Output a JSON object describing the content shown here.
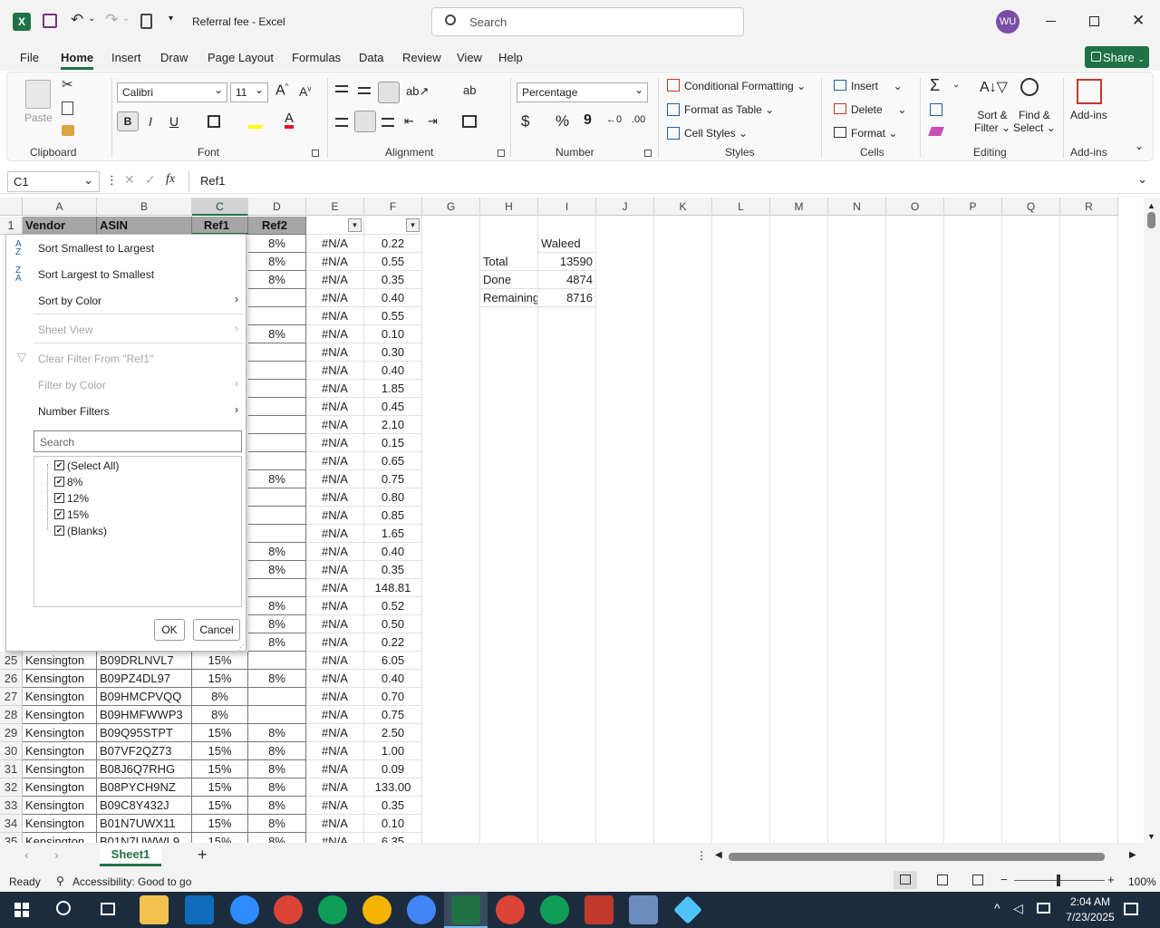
{
  "titlebar": {
    "file_title": "Referral fee",
    "app": "Excel",
    "search_placeholder": "Search",
    "user_initials": "WU"
  },
  "menu": [
    "File",
    "Home",
    "Insert",
    "Draw",
    "Page Layout",
    "Formulas",
    "Data",
    "Review",
    "View",
    "Help"
  ],
  "share_label": "Share",
  "ribbon": {
    "clipboard": {
      "paste": "Paste",
      "label": "Clipboard"
    },
    "font": {
      "name": "Calibri",
      "size": "11",
      "bold": "B",
      "italic": "I",
      "underline": "U",
      "label": "Font"
    },
    "alignment": {
      "label": "Alignment"
    },
    "number": {
      "format": "Percentage",
      "currency": "$",
      "percent": "%",
      "comma": "9",
      "label": "Number"
    },
    "styles": {
      "conditional": "Conditional Formatting",
      "table": "Format as Table",
      "cell_styles": "Cell Styles",
      "label": "Styles"
    },
    "cells": {
      "insert": "Insert",
      "delete": "Delete",
      "format": "Format",
      "label": "Cells"
    },
    "editing": {
      "sort1": "Sort &",
      "sort2": "Filter",
      "find1": "Find &",
      "find2": "Select",
      "label": "Editing"
    },
    "addins": {
      "btn": "Add-ins",
      "label": "Add-ins"
    }
  },
  "formula_bar": {
    "name_box": "C1",
    "fx": "fx",
    "value": "Ref1"
  },
  "columns": [
    "A",
    "B",
    "C",
    "D",
    "E",
    "F",
    "G",
    "H",
    "I",
    "J",
    "K",
    "L",
    "M",
    "N",
    "O",
    "P",
    "Q",
    "R"
  ],
  "row_numbers": [
    "1",
    "25",
    "26",
    "27",
    "28",
    "29",
    "30",
    "31",
    "32",
    "33",
    "34",
    "35"
  ],
  "headers": {
    "a": "Vendor",
    "b": "ASIN",
    "c": "Ref1",
    "d": "Ref2"
  },
  "d_col": [
    "8%",
    "8%",
    "8%",
    "",
    "",
    "8%",
    "",
    "",
    "",
    "",
    "",
    "",
    "",
    "8%",
    "",
    "",
    "",
    "8%",
    "8%",
    "",
    "8%",
    "8%",
    "8%"
  ],
  "e_col": [
    "#N/A",
    "#N/A",
    "#N/A",
    "#N/A",
    "#N/A",
    "#N/A",
    "#N/A",
    "#N/A",
    "#N/A",
    "#N/A",
    "#N/A",
    "#N/A",
    "#N/A",
    "#N/A",
    "#N/A",
    "#N/A",
    "#N/A",
    "#N/A",
    "#N/A",
    "#N/A",
    "#N/A",
    "#N/A",
    "#N/A"
  ],
  "f_col": [
    "0.22",
    "0.55",
    "0.35",
    "0.40",
    "0.55",
    "0.10",
    "0.30",
    "0.40",
    "1.85",
    "0.45",
    "2.10",
    "0.15",
    "0.65",
    "0.75",
    "0.80",
    "0.85",
    "1.65",
    "0.40",
    "0.35",
    "148.81",
    "0.52",
    "0.50",
    "0.22"
  ],
  "rows": [
    {
      "a": "Kensington",
      "b": "B09DRLNVL7",
      "c": "15%",
      "d": "",
      "e": "#N/A",
      "f": "6.05"
    },
    {
      "a": "Kensington",
      "b": "B09PZ4DL97",
      "c": "15%",
      "d": "8%",
      "e": "#N/A",
      "f": "0.40"
    },
    {
      "a": "Kensington",
      "b": "B09HMCPVQQ",
      "c": "8%",
      "d": "",
      "e": "#N/A",
      "f": "0.70"
    },
    {
      "a": "Kensington",
      "b": "B09HMFWWP3",
      "c": "8%",
      "d": "",
      "e": "#N/A",
      "f": "0.75"
    },
    {
      "a": "Kensington",
      "b": "B09Q95STPT",
      "c": "15%",
      "d": "8%",
      "e": "#N/A",
      "f": "2.50"
    },
    {
      "a": "Kensington",
      "b": "B07VF2QZ73",
      "c": "15%",
      "d": "8%",
      "e": "#N/A",
      "f": "1.00"
    },
    {
      "a": "Kensington",
      "b": "B08J6Q7RHG",
      "c": "15%",
      "d": "8%",
      "e": "#N/A",
      "f": "0.09"
    },
    {
      "a": "Kensington",
      "b": "B08PYCH9NZ",
      "c": "15%",
      "d": "8%",
      "e": "#N/A",
      "f": "133.00"
    },
    {
      "a": "Kensington",
      "b": "B09C8Y432J",
      "c": "15%",
      "d": "8%",
      "e": "#N/A",
      "f": "0.35"
    },
    {
      "a": "Kensington",
      "b": "B01N7UWX11",
      "c": "15%",
      "d": "8%",
      "e": "#N/A",
      "f": "0.10"
    },
    {
      "a": "Kensington",
      "b": "B01N7UWWL9",
      "c": "15%",
      "d": "8%",
      "e": "#N/A",
      "f": "6.35"
    }
  ],
  "summary": {
    "name": "Waleed",
    "total_label": "Total",
    "total": "13590",
    "done_label": "Done",
    "done": "4874",
    "remaining_label": "Remaining",
    "remaining": "8716"
  },
  "filter_menu": {
    "sort_asc": "Sort Smallest to Largest",
    "sort_desc": "Sort Largest to Smallest",
    "sort_color": "Sort by Color",
    "sheet_view": "Sheet View",
    "clear": "Clear Filter From \"Ref1\"",
    "filter_color": "Filter by Color",
    "number_filters": "Number Filters",
    "search_placeholder": "Search",
    "options": [
      "(Select All)",
      "8%",
      "12%",
      "15%",
      "(Blanks)"
    ],
    "ok": "OK",
    "cancel": "Cancel"
  },
  "sheet_tab": "Sheet1",
  "status": {
    "ready": "Ready",
    "accessibility": "Accessibility: Good to go",
    "zoom": "100%"
  },
  "clock": {
    "time": "2:04 AM",
    "date": "7/23/2025"
  }
}
